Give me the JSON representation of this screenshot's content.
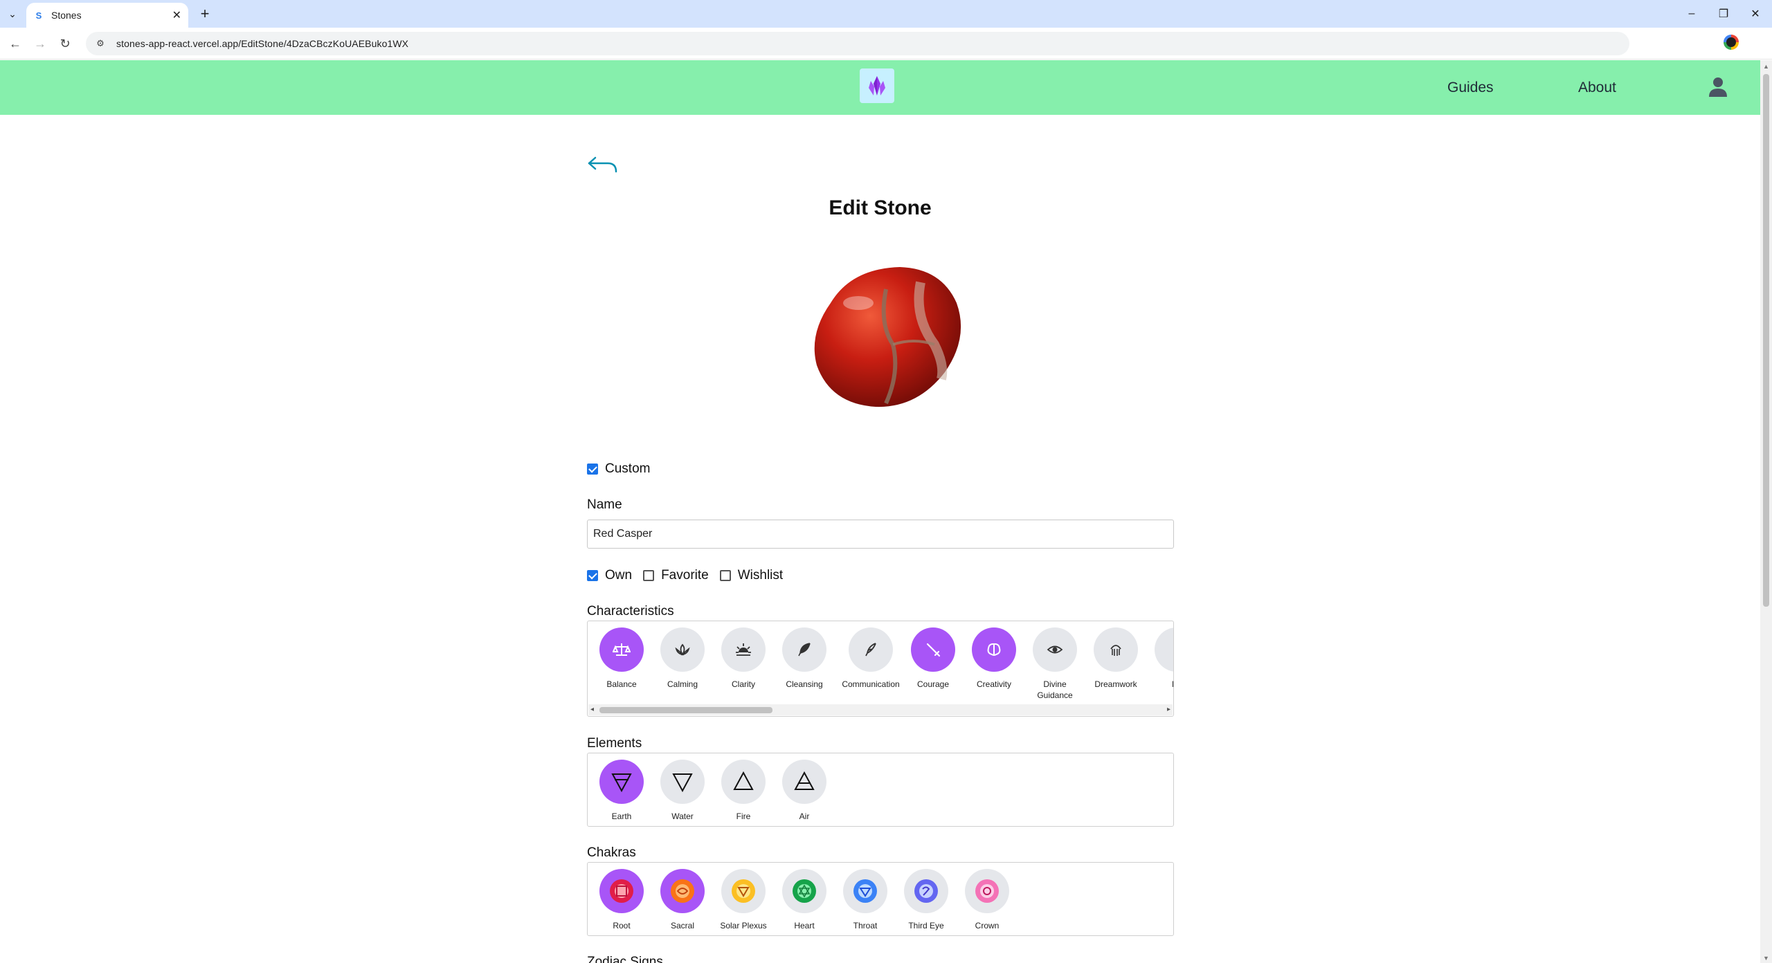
{
  "browser": {
    "tab_title": "Stones",
    "tab_favicon": "S",
    "url": "stones-app-react.vercel.app/EditStone/4DzaCBczKoUAEBuko1WX"
  },
  "header": {
    "nav": [
      "Guides",
      "About"
    ],
    "logo_icon": "crystal-logo-icon",
    "user_icon": "user-icon",
    "bg_color": "#86efac"
  },
  "page": {
    "title": "Edit Stone",
    "custom_label": "Custom",
    "custom_checked": true,
    "name_label": "Name",
    "name_value": "Red Casper",
    "flags": [
      {
        "label": "Own",
        "checked": true
      },
      {
        "label": "Favorite",
        "checked": false
      },
      {
        "label": "Wishlist",
        "checked": false
      }
    ]
  },
  "characteristics": {
    "label": "Characteristics",
    "items": [
      {
        "label": "Balance",
        "selected": true,
        "icon": "balance-scale-icon"
      },
      {
        "label": "Calming",
        "selected": false,
        "icon": "lotus-icon"
      },
      {
        "label": "Clarity",
        "selected": false,
        "icon": "sun-icon"
      },
      {
        "label": "Cleansing",
        "selected": false,
        "icon": "feather-icon"
      },
      {
        "label": "Communication",
        "selected": false,
        "icon": "quill-icon"
      },
      {
        "label": "Courage",
        "selected": true,
        "icon": "sword-icon"
      },
      {
        "label": "Creativity",
        "selected": true,
        "icon": "brain-icon"
      },
      {
        "label": "Divine Guidance",
        "selected": false,
        "icon": "eye-icon"
      },
      {
        "label": "Dreamwork",
        "selected": false,
        "icon": "dreamcatcher-icon"
      },
      {
        "label": "Fo",
        "selected": false,
        "icon": "partial-icon"
      }
    ]
  },
  "elements": {
    "label": "Elements",
    "items": [
      {
        "label": "Earth",
        "selected": true,
        "icon": "earth-element-icon"
      },
      {
        "label": "Water",
        "selected": false,
        "icon": "water-element-icon"
      },
      {
        "label": "Fire",
        "selected": false,
        "icon": "fire-element-icon"
      },
      {
        "label": "Air",
        "selected": false,
        "icon": "air-element-icon"
      }
    ]
  },
  "chakras": {
    "label": "Chakras",
    "items": [
      {
        "label": "Root",
        "selected": true,
        "color": "#e11d48"
      },
      {
        "label": "Sacral",
        "selected": true,
        "color": "#f97316"
      },
      {
        "label": "Solar Plexus",
        "selected": false,
        "color": "#f59e0b"
      },
      {
        "label": "Heart",
        "selected": false,
        "color": "#16a34a"
      },
      {
        "label": "Throat",
        "selected": false,
        "color": "#3b82f6"
      },
      {
        "label": "Third Eye",
        "selected": false,
        "color": "#6366f1"
      },
      {
        "label": "Crown",
        "selected": false,
        "color": "#ec4899"
      }
    ]
  },
  "next_section_label": "Zodiac Signs",
  "colors": {
    "accent_purple": "#a855f7",
    "unselected_gray": "#e5e7eb",
    "back_arrow": "#0891b2"
  }
}
